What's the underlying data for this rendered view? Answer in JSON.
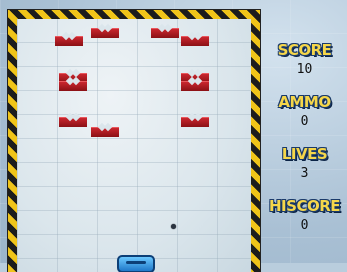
{
  "hud": {
    "score_label": "SCORE",
    "score_value": "10",
    "ammo_label": "AMMO",
    "ammo_value": "0",
    "lives_label": "LIVES",
    "lives_value": "3",
    "hiscore_label": "HISCORE",
    "hiscore_value": "0"
  },
  "colors": {
    "brick": "#b3191f",
    "hazard_yellow": "#f0c419",
    "hazard_black": "#1c1c1c",
    "hud_text": "#f5d64a",
    "paddle": "#3aa3e8"
  },
  "bricks": [
    {
      "name": "brick-1"
    },
    {
      "name": "brick-2"
    },
    {
      "name": "brick-3"
    },
    {
      "name": "brick-4"
    },
    {
      "name": "brick-5"
    },
    {
      "name": "brick-6"
    },
    {
      "name": "brick-7"
    },
    {
      "name": "brick-8"
    },
    {
      "name": "brick-9"
    },
    {
      "name": "brick-10"
    },
    {
      "name": "brick-11"
    },
    {
      "name": "brick-12"
    }
  ]
}
